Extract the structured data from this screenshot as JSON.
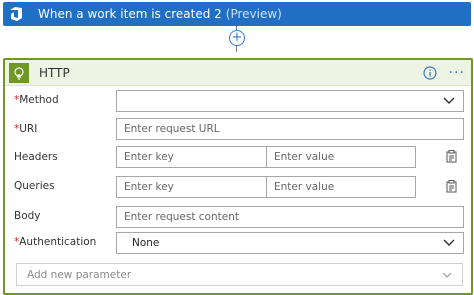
{
  "trigger": {
    "title": "When a work item is created 2",
    "subtitle": "(Preview)",
    "color": "#1f6fc5"
  },
  "action": {
    "title": "HTTP",
    "accent": "#709727",
    "fields": {
      "method": {
        "label": "Method",
        "required": true,
        "value": ""
      },
      "uri": {
        "label": "URI",
        "required": true,
        "placeholder": "Enter request URL"
      },
      "headers": {
        "label": "Headers",
        "key_placeholder": "Enter key",
        "value_placeholder": "Enter value"
      },
      "queries": {
        "label": "Queries",
        "key_placeholder": "Enter key",
        "value_placeholder": "Enter value"
      },
      "body": {
        "label": "Body",
        "placeholder": "Enter request content"
      },
      "authentication": {
        "label": "Authentication",
        "required": true,
        "value": "None"
      }
    },
    "add_parameter": "Add new parameter"
  },
  "icons": {
    "trigger": "azure-devops-icon",
    "action": "http-globe-icon",
    "info": "info-icon",
    "more": "more-options-icon",
    "add": "add-step-icon",
    "switch": "switch-to-text-mode-icon"
  }
}
